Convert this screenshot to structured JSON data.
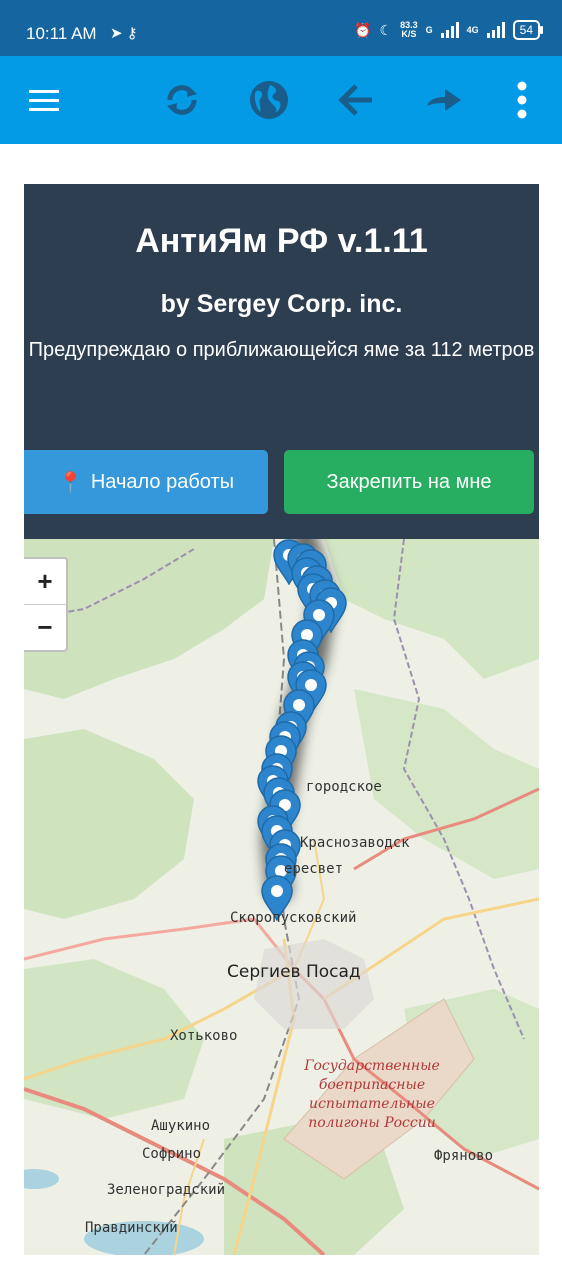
{
  "status_bar": {
    "time": "10:11 AM",
    "left_icons": [
      "telegram-icon",
      "key-icon"
    ],
    "right_icons": [
      "alarm-icon",
      "moon-icon"
    ],
    "net_speed_value": "83.3",
    "net_speed_unit": "K/S",
    "signal_1_label": "G",
    "signal_2_label": "4G",
    "battery": "54"
  },
  "toolbar": {
    "icons": [
      "menu-icon",
      "refresh-icon",
      "globe-icon",
      "back-arrow-icon",
      "forward-arrow-icon",
      "more-vert-icon"
    ]
  },
  "header": {
    "title": "АнтиЯм РФ v.1.11",
    "subtitle": "by Sergey Corp. inc.",
    "description": "Предупреждаю о приближающейся яме за 112 метров"
  },
  "buttons": {
    "start_icon": "📍",
    "start_label": "Начало работы",
    "pin_label": "Закрепить на мне"
  },
  "map": {
    "zoom_in": "+",
    "zoom_out": "−",
    "labels": {
      "gorodskoe": "городское",
      "krasnozavodsk": "Краснозаводск",
      "peresvet": "ересвет",
      "skoropuskovsky": "Скоропусковский",
      "sergiev_posad": "Сергиев Посад",
      "khotkovo": "Хотьково",
      "testing_ground": "Государственные боеприпасные испытательные полигоны России",
      "ashukino": "Ашукино",
      "sofrino": "Софрино",
      "fryanovo": "Фряново",
      "zelenogradsky": "Зеленоградский",
      "pravdinsky": "Правдинский"
    },
    "colors": {
      "marker": "#2d86cd",
      "forest": "#cfe3c0",
      "road_major": "#e88b7e",
      "road_minor": "#f6d48a"
    }
  }
}
